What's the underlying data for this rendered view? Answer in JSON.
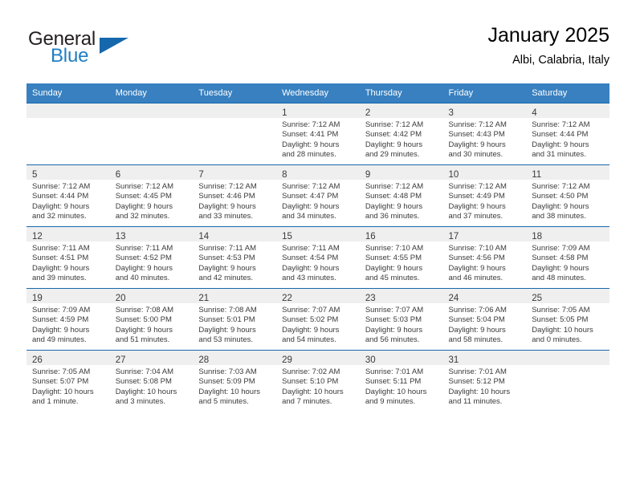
{
  "brand": {
    "name_part1": "General",
    "name_part2": "Blue",
    "triangle_color": "#1668ad",
    "blue_color": "#1f7fc4"
  },
  "header": {
    "title": "January 2025",
    "subtitle": "Albi, Calabria, Italy"
  },
  "theme": {
    "header_row_bg": "#3880c0",
    "week_separator": "#1668ad",
    "daynum_band_bg": "#efefef",
    "text": "#3a3a3a"
  },
  "weekdays": [
    "Sunday",
    "Monday",
    "Tuesday",
    "Wednesday",
    "Thursday",
    "Friday",
    "Saturday"
  ],
  "weeks": [
    [
      {
        "day": "",
        "empty": true
      },
      {
        "day": "",
        "empty": true
      },
      {
        "day": "",
        "empty": true
      },
      {
        "day": "1",
        "sunrise": "Sunrise: 7:12 AM",
        "sunset": "Sunset: 4:41 PM",
        "daylight1": "Daylight: 9 hours",
        "daylight2": "and 28 minutes."
      },
      {
        "day": "2",
        "sunrise": "Sunrise: 7:12 AM",
        "sunset": "Sunset: 4:42 PM",
        "daylight1": "Daylight: 9 hours",
        "daylight2": "and 29 minutes."
      },
      {
        "day": "3",
        "sunrise": "Sunrise: 7:12 AM",
        "sunset": "Sunset: 4:43 PM",
        "daylight1": "Daylight: 9 hours",
        "daylight2": "and 30 minutes."
      },
      {
        "day": "4",
        "sunrise": "Sunrise: 7:12 AM",
        "sunset": "Sunset: 4:44 PM",
        "daylight1": "Daylight: 9 hours",
        "daylight2": "and 31 minutes."
      }
    ],
    [
      {
        "day": "5",
        "sunrise": "Sunrise: 7:12 AM",
        "sunset": "Sunset: 4:44 PM",
        "daylight1": "Daylight: 9 hours",
        "daylight2": "and 32 minutes."
      },
      {
        "day": "6",
        "sunrise": "Sunrise: 7:12 AM",
        "sunset": "Sunset: 4:45 PM",
        "daylight1": "Daylight: 9 hours",
        "daylight2": "and 32 minutes."
      },
      {
        "day": "7",
        "sunrise": "Sunrise: 7:12 AM",
        "sunset": "Sunset: 4:46 PM",
        "daylight1": "Daylight: 9 hours",
        "daylight2": "and 33 minutes."
      },
      {
        "day": "8",
        "sunrise": "Sunrise: 7:12 AM",
        "sunset": "Sunset: 4:47 PM",
        "daylight1": "Daylight: 9 hours",
        "daylight2": "and 34 minutes."
      },
      {
        "day": "9",
        "sunrise": "Sunrise: 7:12 AM",
        "sunset": "Sunset: 4:48 PM",
        "daylight1": "Daylight: 9 hours",
        "daylight2": "and 36 minutes."
      },
      {
        "day": "10",
        "sunrise": "Sunrise: 7:12 AM",
        "sunset": "Sunset: 4:49 PM",
        "daylight1": "Daylight: 9 hours",
        "daylight2": "and 37 minutes."
      },
      {
        "day": "11",
        "sunrise": "Sunrise: 7:12 AM",
        "sunset": "Sunset: 4:50 PM",
        "daylight1": "Daylight: 9 hours",
        "daylight2": "and 38 minutes."
      }
    ],
    [
      {
        "day": "12",
        "sunrise": "Sunrise: 7:11 AM",
        "sunset": "Sunset: 4:51 PM",
        "daylight1": "Daylight: 9 hours",
        "daylight2": "and 39 minutes."
      },
      {
        "day": "13",
        "sunrise": "Sunrise: 7:11 AM",
        "sunset": "Sunset: 4:52 PM",
        "daylight1": "Daylight: 9 hours",
        "daylight2": "and 40 minutes."
      },
      {
        "day": "14",
        "sunrise": "Sunrise: 7:11 AM",
        "sunset": "Sunset: 4:53 PM",
        "daylight1": "Daylight: 9 hours",
        "daylight2": "and 42 minutes."
      },
      {
        "day": "15",
        "sunrise": "Sunrise: 7:11 AM",
        "sunset": "Sunset: 4:54 PM",
        "daylight1": "Daylight: 9 hours",
        "daylight2": "and 43 minutes."
      },
      {
        "day": "16",
        "sunrise": "Sunrise: 7:10 AM",
        "sunset": "Sunset: 4:55 PM",
        "daylight1": "Daylight: 9 hours",
        "daylight2": "and 45 minutes."
      },
      {
        "day": "17",
        "sunrise": "Sunrise: 7:10 AM",
        "sunset": "Sunset: 4:56 PM",
        "daylight1": "Daylight: 9 hours",
        "daylight2": "and 46 minutes."
      },
      {
        "day": "18",
        "sunrise": "Sunrise: 7:09 AM",
        "sunset": "Sunset: 4:58 PM",
        "daylight1": "Daylight: 9 hours",
        "daylight2": "and 48 minutes."
      }
    ],
    [
      {
        "day": "19",
        "sunrise": "Sunrise: 7:09 AM",
        "sunset": "Sunset: 4:59 PM",
        "daylight1": "Daylight: 9 hours",
        "daylight2": "and 49 minutes."
      },
      {
        "day": "20",
        "sunrise": "Sunrise: 7:08 AM",
        "sunset": "Sunset: 5:00 PM",
        "daylight1": "Daylight: 9 hours",
        "daylight2": "and 51 minutes."
      },
      {
        "day": "21",
        "sunrise": "Sunrise: 7:08 AM",
        "sunset": "Sunset: 5:01 PM",
        "daylight1": "Daylight: 9 hours",
        "daylight2": "and 53 minutes."
      },
      {
        "day": "22",
        "sunrise": "Sunrise: 7:07 AM",
        "sunset": "Sunset: 5:02 PM",
        "daylight1": "Daylight: 9 hours",
        "daylight2": "and 54 minutes."
      },
      {
        "day": "23",
        "sunrise": "Sunrise: 7:07 AM",
        "sunset": "Sunset: 5:03 PM",
        "daylight1": "Daylight: 9 hours",
        "daylight2": "and 56 minutes."
      },
      {
        "day": "24",
        "sunrise": "Sunrise: 7:06 AM",
        "sunset": "Sunset: 5:04 PM",
        "daylight1": "Daylight: 9 hours",
        "daylight2": "and 58 minutes."
      },
      {
        "day": "25",
        "sunrise": "Sunrise: 7:05 AM",
        "sunset": "Sunset: 5:05 PM",
        "daylight1": "Daylight: 10 hours",
        "daylight2": "and 0 minutes."
      }
    ],
    [
      {
        "day": "26",
        "sunrise": "Sunrise: 7:05 AM",
        "sunset": "Sunset: 5:07 PM",
        "daylight1": "Daylight: 10 hours",
        "daylight2": "and 1 minute."
      },
      {
        "day": "27",
        "sunrise": "Sunrise: 7:04 AM",
        "sunset": "Sunset: 5:08 PM",
        "daylight1": "Daylight: 10 hours",
        "daylight2": "and 3 minutes."
      },
      {
        "day": "28",
        "sunrise": "Sunrise: 7:03 AM",
        "sunset": "Sunset: 5:09 PM",
        "daylight1": "Daylight: 10 hours",
        "daylight2": "and 5 minutes."
      },
      {
        "day": "29",
        "sunrise": "Sunrise: 7:02 AM",
        "sunset": "Sunset: 5:10 PM",
        "daylight1": "Daylight: 10 hours",
        "daylight2": "and 7 minutes."
      },
      {
        "day": "30",
        "sunrise": "Sunrise: 7:01 AM",
        "sunset": "Sunset: 5:11 PM",
        "daylight1": "Daylight: 10 hours",
        "daylight2": "and 9 minutes."
      },
      {
        "day": "31",
        "sunrise": "Sunrise: 7:01 AM",
        "sunset": "Sunset: 5:12 PM",
        "daylight1": "Daylight: 10 hours",
        "daylight2": "and 11 minutes."
      },
      {
        "day": "",
        "empty": true
      }
    ]
  ]
}
